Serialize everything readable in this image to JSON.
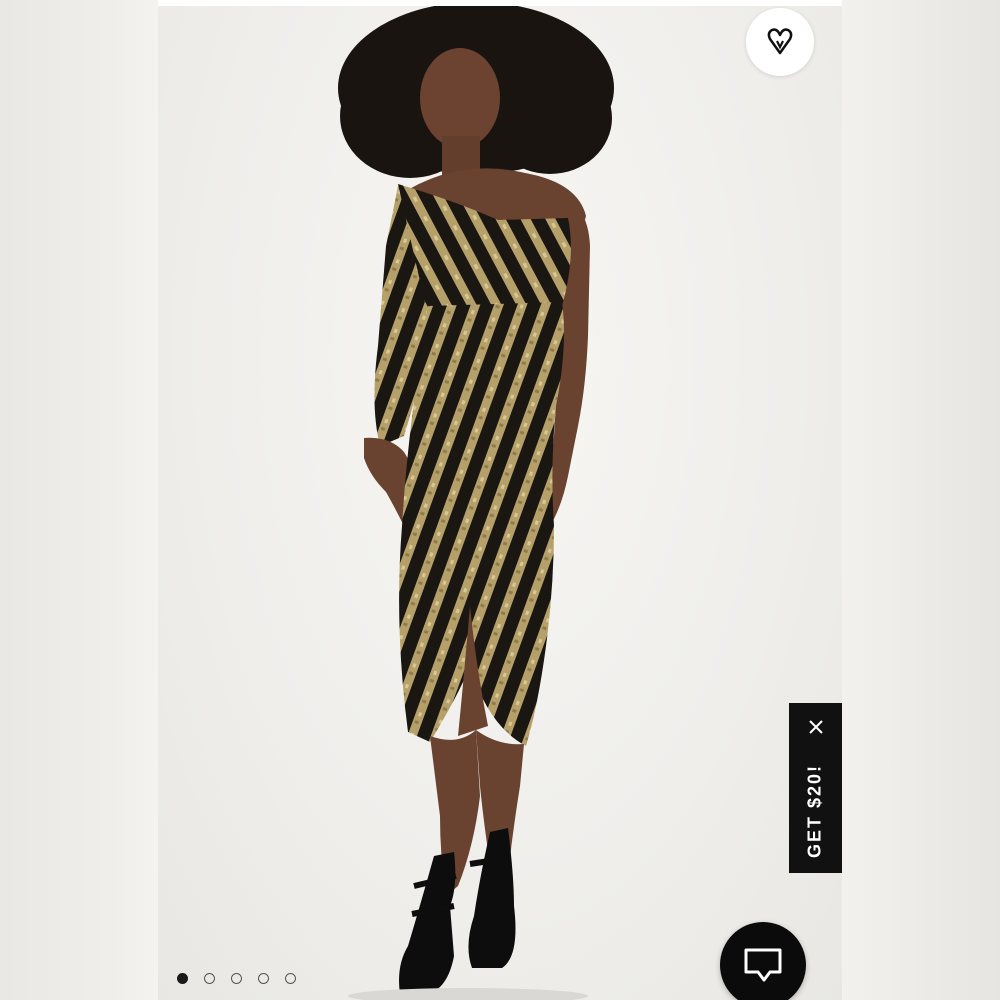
{
  "product_image": {
    "alt_subject": "model-wearing-sequin-one-shoulder-dress",
    "dress_colors": {
      "base": "#1a1713",
      "sequin": "#b6a06a"
    }
  },
  "wishlist": {
    "icon": "heart-outline-icon"
  },
  "promo": {
    "label": "GET $20!",
    "close_icon": "close-icon",
    "bg": "#111111"
  },
  "chat": {
    "icon": "chat-bubble-icon",
    "bg": "#0b0b0b"
  },
  "carousel": {
    "count": 5,
    "active_index": 0
  }
}
